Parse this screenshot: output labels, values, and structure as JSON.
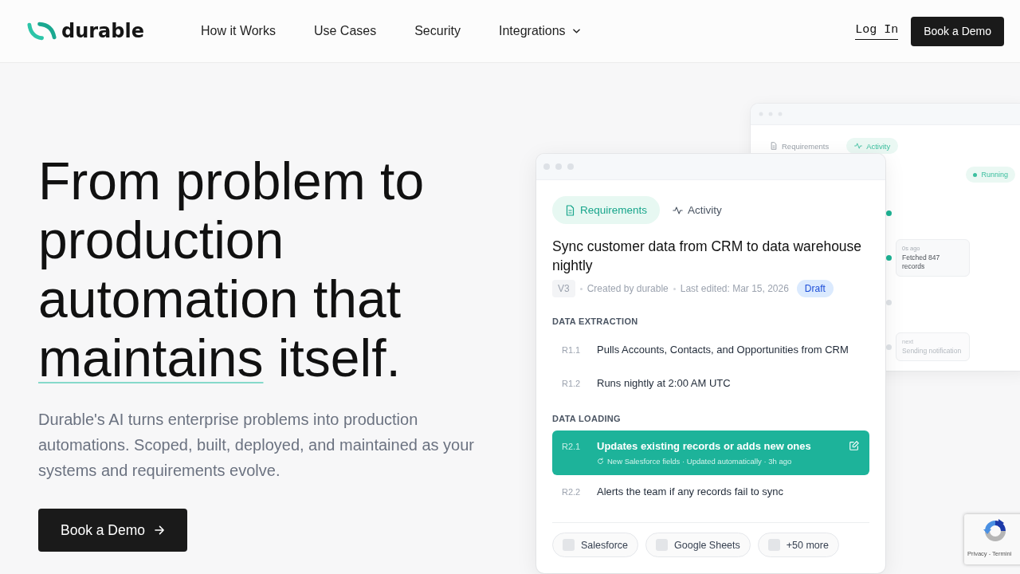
{
  "nav": {
    "logo": "durable",
    "links": [
      {
        "label": "How it Works",
        "has_menu": false
      },
      {
        "label": "Use Cases",
        "has_menu": false
      },
      {
        "label": "Security",
        "has_menu": false
      },
      {
        "label": "Integrations",
        "has_menu": true
      }
    ],
    "login": "Log In",
    "cta": "Book a Demo"
  },
  "hero": {
    "heading": [
      {
        "text": "From problem to production automation that",
        "underlined": false
      },
      {
        "text": "maintains",
        "underlined": true
      },
      {
        "text": "itself.",
        "underlined": false
      }
    ],
    "description": "Durable's AI turns enterprise problems into production automations. Scoped, built, deployed, and maintained as your systems and requirements evolve.",
    "cta": "Book a Demo"
  },
  "activity_card": {
    "tabs": [
      {
        "label": "Requirements",
        "selected": false
      },
      {
        "label": "Activity",
        "selected": true
      }
    ],
    "status": "Running",
    "timeline": [
      {
        "done": true
      },
      {
        "done": true,
        "time": "0s ago",
        "text": "Fetched 847 records"
      },
      {
        "done": false
      },
      {
        "done": false,
        "time": "next",
        "text": "Sending notification"
      }
    ]
  },
  "requirements_card": {
    "tabs": [
      {
        "label": "Requirements",
        "selected": true
      },
      {
        "label": "Activity",
        "selected": false
      }
    ],
    "title": "Sync customer data from CRM to data warehouse nightly",
    "version": "V3",
    "created_by": "Created by durable",
    "last_edited": "Last edited: Mar 15, 2026",
    "status": "Draft",
    "sections": [
      {
        "title": "DATA EXTRACTION",
        "items": [
          {
            "id": "R1.1",
            "text": "Pulls Accounts, Contacts, and Opportunities from CRM",
            "highlighted": false
          },
          {
            "id": "R1.2",
            "text": "Runs nightly at 2:00 AM UTC",
            "highlighted": false
          }
        ]
      },
      {
        "title": "DATA LOADING",
        "items": [
          {
            "id": "R2.1",
            "text": "Updates existing records or adds new ones",
            "highlighted": true,
            "note": "New Salesforce fields · Updated automatically · 3h ago"
          },
          {
            "id": "R2.2",
            "text": "Alerts the team if any records fail to sync",
            "highlighted": false
          }
        ]
      }
    ],
    "integrations": [
      "Salesforce",
      "Google Sheets",
      "+50 more"
    ]
  },
  "captcha": {
    "links": "Privacy - Termini"
  }
}
